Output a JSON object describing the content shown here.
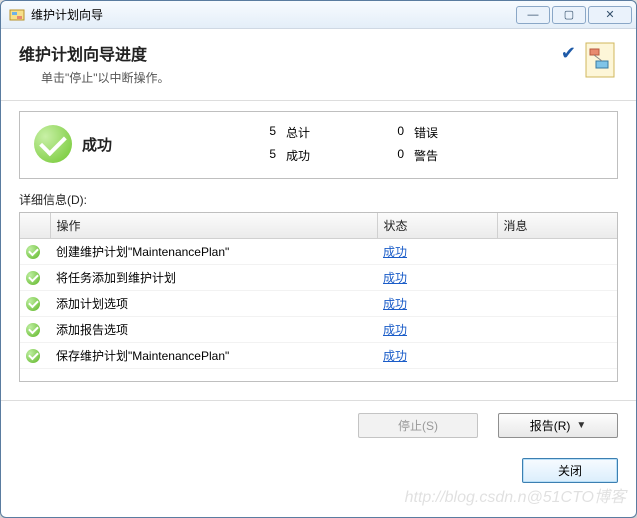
{
  "window": {
    "title": "维护计划向导"
  },
  "header": {
    "title": "维护计划向导进度",
    "subtitle": "单击\"停止\"以中断操作。"
  },
  "summary": {
    "status_label": "成功",
    "total_n": "5",
    "total_label": "总计",
    "success_n": "5",
    "success_label": "成功",
    "error_n": "0",
    "error_label": "错误",
    "warning_n": "0",
    "warning_label": "警告"
  },
  "details_label": "详细信息(D):",
  "columns": {
    "action": "操作",
    "status": "状态",
    "message": "消息"
  },
  "rows": [
    {
      "action": "创建维护计划\"MaintenancePlan\"",
      "status": "成功",
      "message": ""
    },
    {
      "action": "将任务添加到维护计划",
      "status": "成功",
      "message": ""
    },
    {
      "action": "添加计划选项",
      "status": "成功",
      "message": ""
    },
    {
      "action": "添加报告选项",
      "status": "成功",
      "message": ""
    },
    {
      "action": "保存维护计划\"MaintenancePlan\"",
      "status": "成功",
      "message": ""
    }
  ],
  "buttons": {
    "stop": "停止(S)",
    "report": "报告(R)",
    "close": "关闭"
  },
  "watermark": "http://blog.csdn.n@51CTO博客"
}
